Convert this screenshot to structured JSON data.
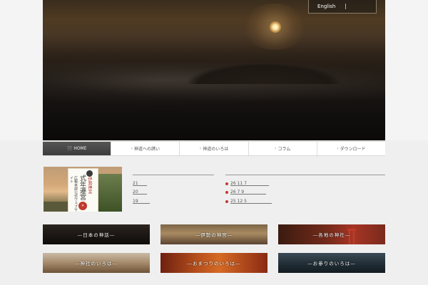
{
  "header": {
    "language_link": "English"
  },
  "nav": {
    "items": [
      {
        "label": "HOME",
        "icon": "torii-icon"
      },
      {
        "label": "神道への誘い",
        "icon": "arrow-icon"
      },
      {
        "label": "神道のいろは",
        "icon": "arrow-icon"
      },
      {
        "label": "コラム",
        "icon": "arrow-icon"
      },
      {
        "label": "ダウンロード",
        "icon": "arrow-icon"
      }
    ]
  },
  "banner": {
    "org": "伊勢神宮",
    "title": "式年遷宮",
    "subtitle": "広報本部公式ウェブサイト"
  },
  "news_left": {
    "rows": [
      "21",
      "20",
      "19"
    ]
  },
  "news_right": {
    "rows": [
      "26 11 7",
      "26 7 9",
      "25 12 5"
    ]
  },
  "tiles": [
    {
      "label": "―日本の神話―"
    },
    {
      "label": "―伊勢の神宮―"
    },
    {
      "label": "―各地の神社―"
    },
    {
      "label": "―神社のいろは―"
    },
    {
      "label": "―おまつりのいろは―"
    },
    {
      "label": "―お参りのいろは―"
    }
  ]
}
